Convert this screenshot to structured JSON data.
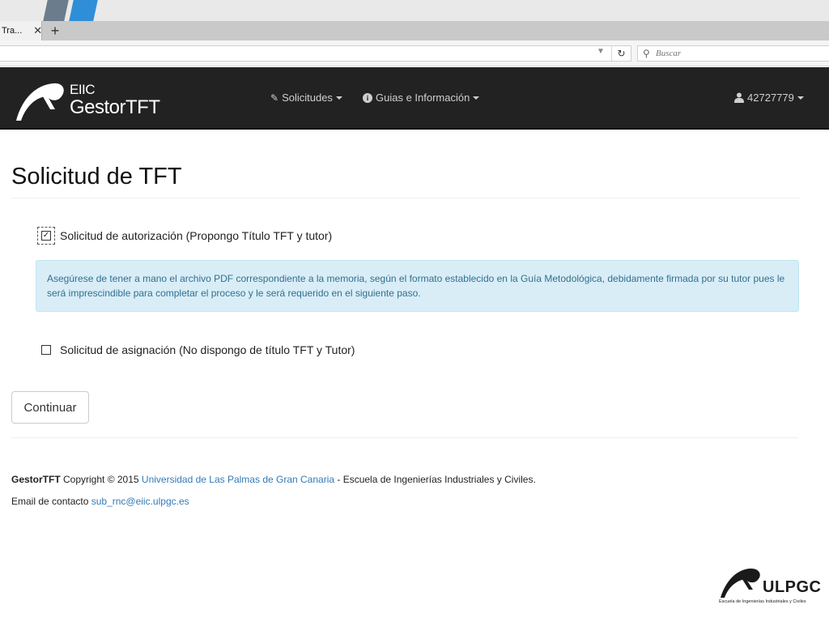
{
  "browser": {
    "tab_title": "Tra...",
    "tab_close_icon": "close-icon",
    "new_tab_label": "+",
    "url": "",
    "search_placeholder": "Buscar"
  },
  "navbar": {
    "brand_small": "EIIC",
    "brand_big": "GestorTFT",
    "items": [
      {
        "label": "Solicitudes",
        "icon": "edit-icon"
      },
      {
        "label": "Guias e Información",
        "icon": "info-icon"
      }
    ],
    "user": {
      "label": "42727779",
      "icon": "user-icon"
    }
  },
  "page": {
    "title": "Solicitud de TFT",
    "option_authorization": {
      "label": "Solicitud de autorización (Propongo Título TFT y tutor)",
      "checked": true
    },
    "alert_text": "Asegúrese de tener a mano el archivo PDF correspondiente a la memoria, según el formato establecido en la Guía Metodológica, debidamente firmada por su tutor pues le será imprescindible para completar el proceso y le será requerido en el siguiente paso.",
    "option_assignment": {
      "label": "Solicitud de asignación (No dispongo de título TFT y Tutor)",
      "checked": false
    },
    "continue_label": "Continuar"
  },
  "footer": {
    "brand": "GestorTFT",
    "copyright": " Copyright © 2015 ",
    "university_link": "Universidad de Las Palmas de Gran Canaria",
    "school": " - Escuela de Ingenierías Industriales y Civiles.",
    "email_label": "Email de contacto ",
    "email_link": "sub_rnc@eiic.ulpgc.es"
  },
  "ulpgc_logo": {
    "name": "ULPGC",
    "subtitle": "Escuela de Ingenierías Industriales y Civiles"
  },
  "colors": {
    "navbar_bg": "#222222",
    "alert_bg": "#d9edf7",
    "alert_text": "#31708f",
    "link": "#337ab7"
  }
}
